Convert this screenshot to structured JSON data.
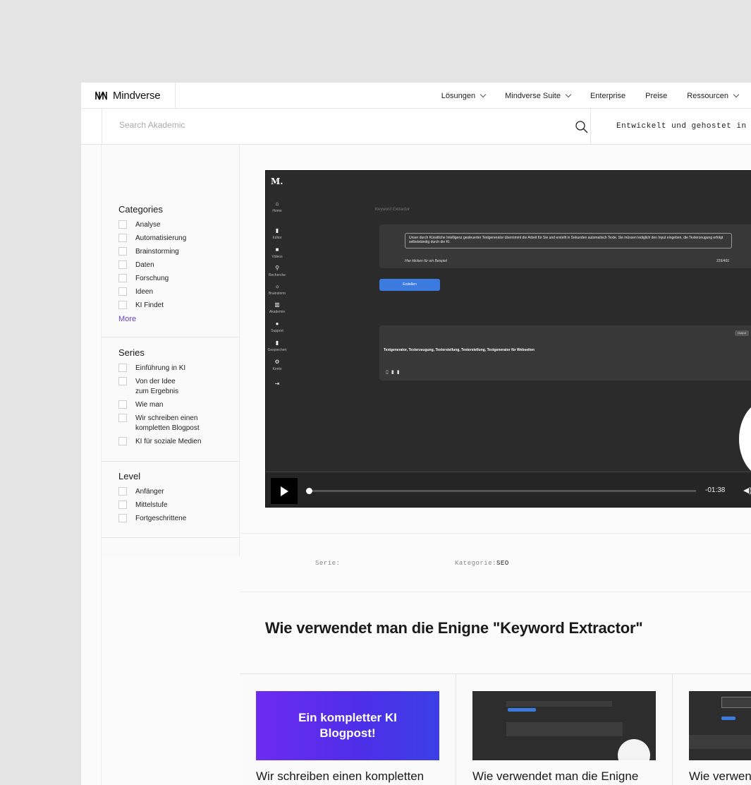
{
  "brand": {
    "name": "Mindverse"
  },
  "nav": {
    "items": [
      {
        "label": "Lösungen",
        "dropdown": true
      },
      {
        "label": "Mindverse Suite",
        "dropdown": true
      },
      {
        "label": "Enterprise",
        "dropdown": false
      },
      {
        "label": "Preise",
        "dropdown": false
      },
      {
        "label": "Ressourcen",
        "dropdown": true
      }
    ]
  },
  "search": {
    "placeholder": "Search Akademic",
    "value": ""
  },
  "hosted_text": "Entwickelt und gehostet in",
  "filters": {
    "categories": {
      "title": "Categories",
      "options": [
        "Analyse",
        "Automatisierung",
        "Brainstorming",
        "Daten",
        "Forschung",
        "Ideen",
        "KI Findet"
      ],
      "more": "More"
    },
    "series": {
      "title": "Series",
      "options": [
        "Einführung in KI",
        "Von der Idee\nzum Ergebnis",
        "Wie man",
        "Wir schreiben einen\nkompletten Blogpost",
        "KI für soziale Medien"
      ]
    },
    "level": {
      "title": "Level",
      "options": [
        "Anfänger",
        "Mittelstufe",
        "Fortgeschrittene"
      ]
    }
  },
  "video": {
    "app_logo": "M.",
    "app_nav": [
      "Home",
      "Editor",
      "Videos",
      "Recherche",
      "Brainstorm",
      "Akademie",
      "Support",
      "Gespeichert",
      "Konto"
    ],
    "page_title": "Keyword Extractor",
    "input_text": "Unser durch Künstliche Intelligenz gesteuerter Textgenerator übernimmt die Arbeit für Sie und erstellt in Sekunden automatisch Texte. Sie müssen lediglich den Input eingeben, die Texterzeugung erfolgt selbstständig durch die KI.",
    "example_hint": "Hier klicken für ein Beispiel",
    "char_count": "229/400",
    "create_button": "Erstellen",
    "output_badge": "Output",
    "output_text": "Textgenerator, Texterzeugung, Texterstellung, Texterstellung, Textgenerator für Webseiten",
    "time": "-01:38",
    "progress": 0.0
  },
  "meta": {
    "serie_label": "Serie:",
    "serie_value": "",
    "kategorie_label": "Kategorie:",
    "kategorie_value": "SEO"
  },
  "headline": "Wie verwendet man die Enigne \"Keyword Extractor\"",
  "related": [
    {
      "thumb_text": "Ein kompletter KI\nBlogpost!",
      "title": "Wir schreiben einen kompletten"
    },
    {
      "thumb_text": "",
      "title": "Wie verwendet man die Enigne"
    },
    {
      "thumb_text": "",
      "title": "Wie verwen"
    }
  ],
  "colors": {
    "accent_link": "#6a3fcf",
    "video_button": "#3b7be0",
    "thumb_purple": "#5a2ee8"
  }
}
